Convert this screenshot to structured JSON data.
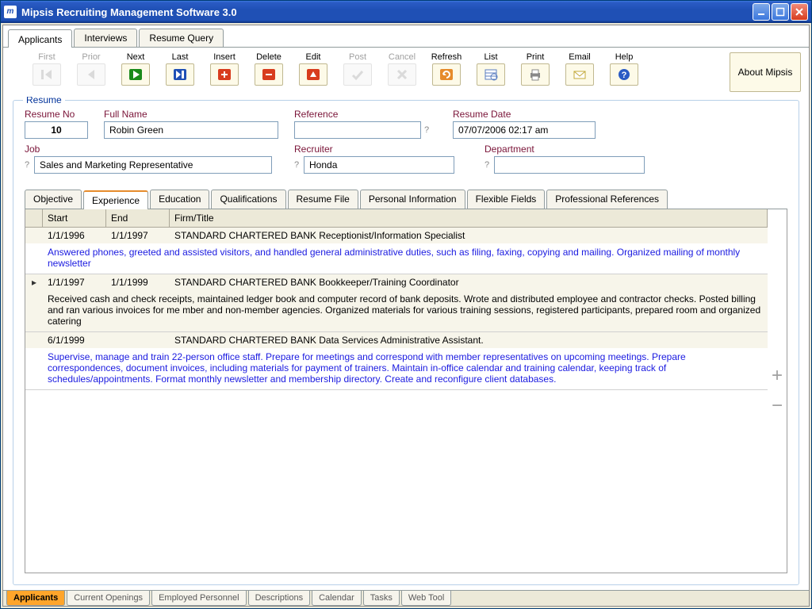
{
  "window": {
    "title": "Mipsis Recruiting Management Software 3.0"
  },
  "top_tabs": [
    {
      "label": "Applicants",
      "active": true
    },
    {
      "label": "Interviews",
      "active": false
    },
    {
      "label": "Resume Query",
      "active": false
    }
  ],
  "toolbar": [
    {
      "label": "First",
      "icon": "nav-first",
      "disabled": true
    },
    {
      "label": "Prior",
      "icon": "nav-prior",
      "disabled": true
    },
    {
      "label": "Next",
      "icon": "nav-next",
      "disabled": false
    },
    {
      "label": "Last",
      "icon": "nav-last",
      "disabled": false
    },
    {
      "label": "Insert",
      "icon": "plus",
      "disabled": false
    },
    {
      "label": "Delete",
      "icon": "minus",
      "disabled": false
    },
    {
      "label": "Edit",
      "icon": "edit",
      "disabled": false
    },
    {
      "label": "Post",
      "icon": "post",
      "disabled": true
    },
    {
      "label": "Cancel",
      "icon": "cancel",
      "disabled": true
    },
    {
      "label": "Refresh",
      "icon": "refresh",
      "disabled": false
    },
    {
      "label": "List",
      "icon": "list",
      "disabled": false
    },
    {
      "label": "Print",
      "icon": "print",
      "disabled": false
    },
    {
      "label": "Email",
      "icon": "email",
      "disabled": false
    },
    {
      "label": "Help",
      "icon": "help",
      "disabled": false
    }
  ],
  "about_label": "About Mipsis",
  "group": {
    "legend": "Resume"
  },
  "fields": {
    "resume_no": {
      "label": "Resume No",
      "value": "10"
    },
    "full_name": {
      "label": "Full Name",
      "value": "Robin Green"
    },
    "reference": {
      "label": "Reference",
      "value": ""
    },
    "resume_date": {
      "label": "Resume Date",
      "value": "07/07/2006 02:17 am"
    },
    "job": {
      "label": "Job",
      "value": "Sales and Marketing Representative"
    },
    "recruiter": {
      "label": "Recruiter",
      "value": "Honda"
    },
    "department": {
      "label": "Department",
      "value": ""
    }
  },
  "inner_tabs": [
    {
      "label": "Objective"
    },
    {
      "label": "Experience",
      "active": true
    },
    {
      "label": "Education"
    },
    {
      "label": "Qualifications"
    },
    {
      "label": "Resume File"
    },
    {
      "label": "Personal Information"
    },
    {
      "label": "Flexible Fields"
    },
    {
      "label": "Professional References"
    }
  ],
  "grid": {
    "headers": {
      "start": "Start",
      "end": "End",
      "firm": "Firm/Title"
    },
    "rows": [
      {
        "start": "1/1/1996",
        "end": "1/1/1997",
        "firm": "STANDARD CHARTERED BANK Receptionist/Information Specialist",
        "desc": "Answered phones, greeted and assisted visitors, and handled general administrative duties, such as filing, faxing, copying and mailing. Organized mailing of monthly newsletter",
        "selected": false
      },
      {
        "start": "1/1/1997",
        "end": "1/1/1999",
        "firm": "STANDARD CHARTERED BANK Bookkeeper/Training Coordinator",
        "desc": "Received cash and check receipts, maintained ledger book and computer record of bank deposits. Wrote and distributed employee and contractor checks. Posted billing and ran various invoices for me mber and non-member agencies. Organized materials for various training sessions, registered participants, prepared room and organized catering",
        "selected": true
      },
      {
        "start": "6/1/1999",
        "end": "",
        "firm": "STANDARD CHARTERED BANK Data Services Administrative Assistant.",
        "desc": "Supervise, manage and train 22-person office staff. Prepare for meetings and correspond with member representatives on upcoming meetings. Prepare correspondences, document invoices, including materials for payment of trainers. Maintain in-office calendar and training calendar, keeping track of schedules/appointments. Format monthly newsletter and membership directory. Create and reconfigure client databases.",
        "selected": false
      }
    ]
  },
  "bottom_tabs": [
    {
      "label": "Applicants",
      "active": true
    },
    {
      "label": "Current Openings"
    },
    {
      "label": "Employed Personnel"
    },
    {
      "label": "Descriptions"
    },
    {
      "label": "Calendar"
    },
    {
      "label": "Tasks"
    },
    {
      "label": "Web Tool"
    }
  ]
}
